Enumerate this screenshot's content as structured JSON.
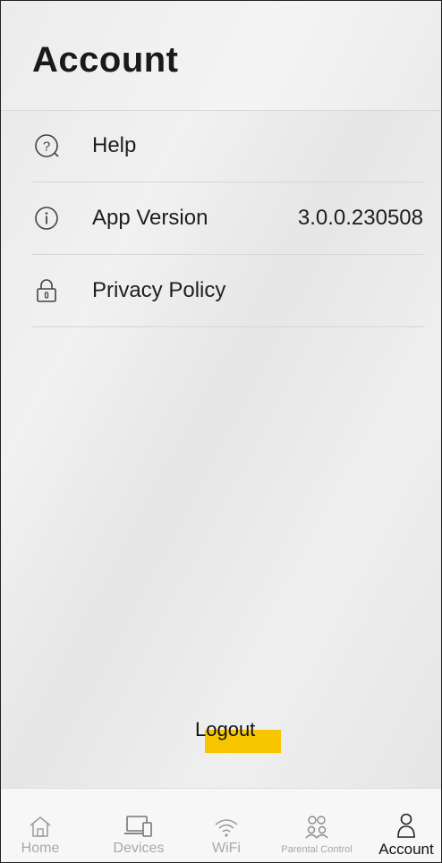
{
  "header": {
    "title": "Account"
  },
  "menu": {
    "items": [
      {
        "label": "Help",
        "icon": "help-icon",
        "value": ""
      },
      {
        "label": "App Version",
        "icon": "info-icon",
        "value": "3.0.0.230508"
      },
      {
        "label": "Privacy Policy",
        "icon": "lock-icon",
        "value": ""
      }
    ]
  },
  "logout": {
    "label": "Logout",
    "highlight_color": "#f7c600"
  },
  "tabbar": {
    "tabs": [
      {
        "label": "Home",
        "icon": "home-icon",
        "active": false
      },
      {
        "label": "Devices",
        "icon": "devices-icon",
        "active": false
      },
      {
        "label": "WiFi",
        "icon": "wifi-icon",
        "active": false
      },
      {
        "label": "Parental Control",
        "icon": "parental-control-icon",
        "active": false
      },
      {
        "label": "Account",
        "icon": "account-icon",
        "active": true
      }
    ]
  }
}
